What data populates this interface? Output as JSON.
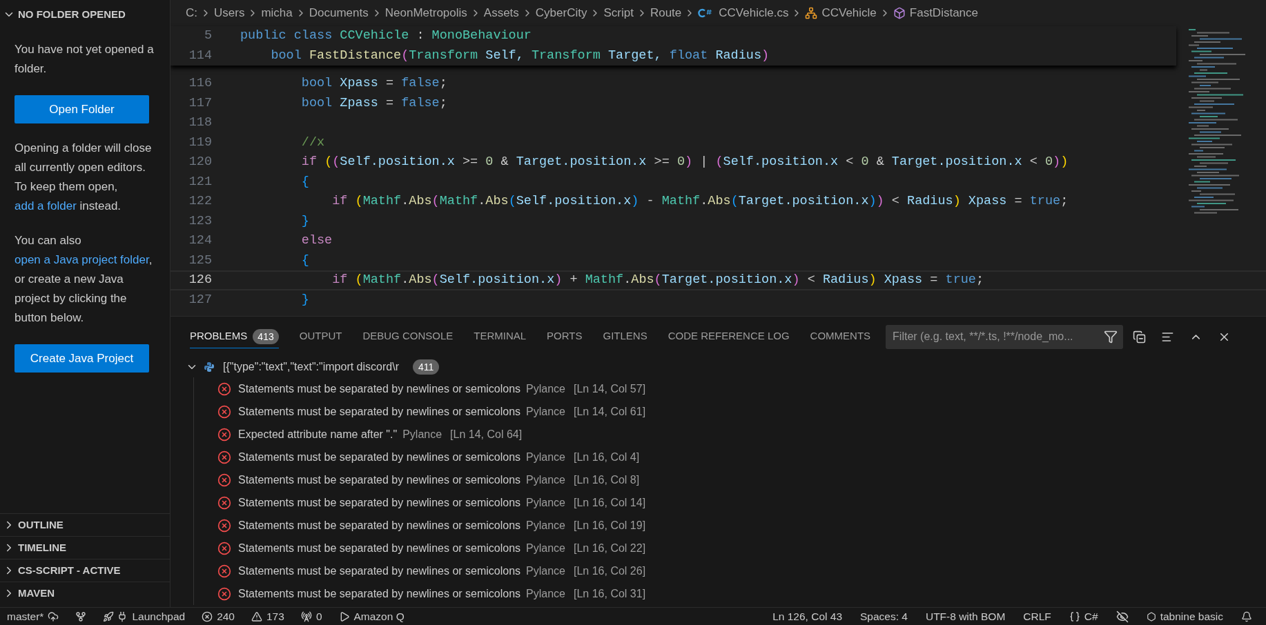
{
  "sidebar": {
    "title": "NO FOLDER OPENED",
    "expanded": true,
    "welcome": [
      {
        "kind": "text",
        "parts": [
          {
            "text": "You have not yet opened a folder.",
            "link": false
          }
        ]
      },
      {
        "kind": "button",
        "label": "Open Folder"
      },
      {
        "kind": "text",
        "parts": [
          {
            "text": "Opening a folder will close all currently open editors. To keep them open, ",
            "link": false
          },
          {
            "text": "add a folder",
            "link": true
          },
          {
            "text": " instead.",
            "link": false
          }
        ]
      },
      {
        "kind": "text",
        "parts": [
          {
            "text": "You can also ",
            "link": false
          },
          {
            "text": "open a Java project folder",
            "link": true
          },
          {
            "text": ", or create a new Java project by clicking the button below.",
            "link": false
          }
        ]
      },
      {
        "kind": "button",
        "label": "Create Java Project"
      }
    ],
    "sections": [
      {
        "label": "OUTLINE",
        "expanded": false
      },
      {
        "label": "TIMELINE",
        "expanded": false
      },
      {
        "label": "CS-SCRIPT - ACTIVE",
        "expanded": false
      },
      {
        "label": "MAVEN",
        "expanded": false
      }
    ]
  },
  "breadcrumb": [
    {
      "kind": "text",
      "label": "C:"
    },
    {
      "kind": "text",
      "label": "Users"
    },
    {
      "kind": "text",
      "label": "micha"
    },
    {
      "kind": "text",
      "label": "Documents"
    },
    {
      "kind": "text",
      "label": "NeonMetropolis"
    },
    {
      "kind": "text",
      "label": "Assets"
    },
    {
      "kind": "text",
      "label": "CyberCity"
    },
    {
      "kind": "text",
      "label": "Script"
    },
    {
      "kind": "text",
      "label": "Route"
    },
    {
      "kind": "file",
      "label": "CCVehicle.cs"
    },
    {
      "kind": "class",
      "label": "CCVehicle"
    },
    {
      "kind": "method",
      "label": "FastDistance"
    }
  ],
  "editor": {
    "sticky_lines": [
      {
        "number": "5",
        "current": false,
        "tokens": [
          {
            "text": "public",
            "kind": "keyword"
          },
          {
            "text": " class",
            "kind": "keyword"
          },
          {
            "text": " CCVehicle",
            "kind": "type"
          },
          {
            "text": " :",
            "kind": "plain"
          },
          {
            "text": " MonoBehaviour",
            "kind": "type"
          }
        ]
      },
      {
        "number": "114",
        "current": false,
        "tokens": [
          {
            "text": "    bool",
            "kind": "keyword"
          },
          {
            "text": " FastDistance",
            "kind": "function"
          },
          {
            "text": "(",
            "kind": "bracket2"
          },
          {
            "text": "Transform",
            "kind": "type"
          },
          {
            "text": " Self,",
            "kind": "variable"
          },
          {
            "text": " Transform",
            "kind": "type"
          },
          {
            "text": " Target,",
            "kind": "variable"
          },
          {
            "text": " float",
            "kind": "keyword"
          },
          {
            "text": " Radius",
            "kind": "variable"
          },
          {
            "text": ")",
            "kind": "bracket2"
          }
        ]
      }
    ],
    "lines": [
      {
        "number": "116",
        "current": false,
        "tokens": [
          {
            "text": "        bool",
            "kind": "keyword"
          },
          {
            "text": " Xpass",
            "kind": "variable"
          },
          {
            "text": " =",
            "kind": "plain"
          },
          {
            "text": " false",
            "kind": "keyword"
          },
          {
            "text": ";",
            "kind": "plain"
          }
        ]
      },
      {
        "number": "117",
        "current": false,
        "tokens": [
          {
            "text": "        bool",
            "kind": "keyword"
          },
          {
            "text": " Zpass",
            "kind": "variable"
          },
          {
            "text": " =",
            "kind": "plain"
          },
          {
            "text": " false",
            "kind": "keyword"
          },
          {
            "text": ";",
            "kind": "plain"
          }
        ]
      },
      {
        "number": "118",
        "current": false
      },
      {
        "number": "119",
        "current": false,
        "tokens": [
          {
            "text": "        //x",
            "kind": "comment"
          }
        ]
      },
      {
        "number": "120",
        "current": false,
        "tokens": [
          {
            "text": "        if",
            "kind": "control"
          },
          {
            "text": " (",
            "kind": "bracket1"
          },
          {
            "text": "(",
            "kind": "bracket2"
          },
          {
            "text": "Self.position.x",
            "kind": "variable"
          },
          {
            "text": " >=",
            "kind": "plain"
          },
          {
            "text": " 0",
            "kind": "number"
          },
          {
            "text": " &",
            "kind": "plain"
          },
          {
            "text": " Target.position.x",
            "kind": "variable"
          },
          {
            "text": " >=",
            "kind": "plain"
          },
          {
            "text": " 0",
            "kind": "number"
          },
          {
            "text": ")",
            "kind": "bracket2"
          },
          {
            "text": " |",
            "kind": "plain"
          },
          {
            "text": " (",
            "kind": "bracket2"
          },
          {
            "text": "Self.position.x",
            "kind": "variable"
          },
          {
            "text": " <",
            "kind": "plain"
          },
          {
            "text": " 0",
            "kind": "number"
          },
          {
            "text": " &",
            "kind": "plain"
          },
          {
            "text": " Target.position.x",
            "kind": "variable"
          },
          {
            "text": " <",
            "kind": "plain"
          },
          {
            "text": " 0",
            "kind": "number"
          },
          {
            "text": ")",
            "kind": "bracket2"
          },
          {
            "text": ")",
            "kind": "bracket1"
          }
        ]
      },
      {
        "number": "121",
        "current": false,
        "tokens": [
          {
            "text": "        {",
            "kind": "bracket3"
          }
        ]
      },
      {
        "number": "122",
        "current": false,
        "tokens": [
          {
            "text": "            if",
            "kind": "control"
          },
          {
            "text": " (",
            "kind": "bracket1"
          },
          {
            "text": "Mathf",
            "kind": "type"
          },
          {
            "text": ".",
            "kind": "plain"
          },
          {
            "text": "Abs",
            "kind": "function"
          },
          {
            "text": "(",
            "kind": "bracket2"
          },
          {
            "text": "Mathf",
            "kind": "type"
          },
          {
            "text": ".",
            "kind": "plain"
          },
          {
            "text": "Abs",
            "kind": "function"
          },
          {
            "text": "(",
            "kind": "bracket3"
          },
          {
            "text": "Self.position.x",
            "kind": "variable"
          },
          {
            "text": ")",
            "kind": "bracket3"
          },
          {
            "text": " -",
            "kind": "plain"
          },
          {
            "text": " Mathf",
            "kind": "type"
          },
          {
            "text": ".",
            "kind": "plain"
          },
          {
            "text": "Abs",
            "kind": "function"
          },
          {
            "text": "(",
            "kind": "bracket3"
          },
          {
            "text": "Target.position.x",
            "kind": "variable"
          },
          {
            "text": ")",
            "kind": "bracket3"
          },
          {
            "text": ")",
            "kind": "bracket2"
          },
          {
            "text": " <",
            "kind": "plain"
          },
          {
            "text": " Radius",
            "kind": "variable"
          },
          {
            "text": ")",
            "kind": "bracket1"
          },
          {
            "text": " Xpass",
            "kind": "variable"
          },
          {
            "text": " =",
            "kind": "plain"
          },
          {
            "text": " true",
            "kind": "keyword"
          },
          {
            "text": ";",
            "kind": "plain"
          }
        ]
      },
      {
        "number": "123",
        "current": false,
        "tokens": [
          {
            "text": "        }",
            "kind": "bracket3"
          }
        ]
      },
      {
        "number": "124",
        "current": false,
        "tokens": [
          {
            "text": "        else",
            "kind": "control"
          }
        ]
      },
      {
        "number": "125",
        "current": false,
        "tokens": [
          {
            "text": "        {",
            "kind": "bracket3"
          }
        ]
      },
      {
        "number": "126",
        "current": true,
        "tokens": [
          {
            "text": "            if",
            "kind": "control"
          },
          {
            "text": " (",
            "kind": "bracket1"
          },
          {
            "text": "Mathf",
            "kind": "type"
          },
          {
            "text": ".",
            "kind": "plain"
          },
          {
            "text": "Abs",
            "kind": "function"
          },
          {
            "text": "(",
            "kind": "bracket2"
          },
          {
            "text": "Self.position.x",
            "kind": "variable"
          },
          {
            "text": ")",
            "kind": "bracket2"
          },
          {
            "text": " +",
            "kind": "plain"
          },
          {
            "text": " Mathf",
            "kind": "type"
          },
          {
            "text": ".",
            "kind": "plain"
          },
          {
            "text": "Abs",
            "kind": "function"
          },
          {
            "text": "(",
            "kind": "bracket2"
          },
          {
            "text": "Target.position.x",
            "kind": "variable"
          },
          {
            "text": ")",
            "kind": "bracket2"
          },
          {
            "text": " <",
            "kind": "plain"
          },
          {
            "text": " Radius",
            "kind": "variable"
          },
          {
            "text": ")",
            "kind": "bracket1"
          },
          {
            "text": " Xpass",
            "kind": "variable"
          },
          {
            "text": " =",
            "kind": "plain"
          },
          {
            "text": " true",
            "kind": "keyword"
          },
          {
            "text": ";",
            "kind": "plain"
          }
        ]
      },
      {
        "number": "127",
        "current": false,
        "tokens": [
          {
            "text": "        }",
            "kind": "bracket3"
          }
        ]
      }
    ]
  },
  "panel": {
    "tabs": [
      {
        "label": "PROBLEMS",
        "selected": true,
        "badge": "413"
      },
      {
        "label": "OUTPUT",
        "selected": false
      },
      {
        "label": "DEBUG CONSOLE",
        "selected": false
      },
      {
        "label": "TERMINAL",
        "selected": false
      },
      {
        "label": "PORTS",
        "selected": false
      },
      {
        "label": "GITLENS",
        "selected": false
      },
      {
        "label": "CODE REFERENCE LOG",
        "selected": false
      },
      {
        "label": "COMMENTS",
        "selected": false
      }
    ],
    "filter": {
      "placeholder": "Filter (e.g. text, **/*.ts, !**/node_mo..."
    },
    "group": {
      "label": "[{\"type\":\"text\",\"text\":\"import discord\\r",
      "count": "411",
      "expanded": true
    },
    "problems": [
      {
        "message": "Statements must be separated by newlines or semicolons",
        "source": "Pylance",
        "location": "[Ln 14, Col 57]"
      },
      {
        "message": "Statements must be separated by newlines or semicolons",
        "source": "Pylance",
        "location": "[Ln 14, Col 61]"
      },
      {
        "message": "Expected attribute name after \".\"",
        "source": "Pylance",
        "location": "[Ln 14, Col 64]"
      },
      {
        "message": "Statements must be separated by newlines or semicolons",
        "source": "Pylance",
        "location": "[Ln 16, Col 4]"
      },
      {
        "message": "Statements must be separated by newlines or semicolons",
        "source": "Pylance",
        "location": "[Ln 16, Col 8]"
      },
      {
        "message": "Statements must be separated by newlines or semicolons",
        "source": "Pylance",
        "location": "[Ln 16, Col 14]"
      },
      {
        "message": "Statements must be separated by newlines or semicolons",
        "source": "Pylance",
        "location": "[Ln 16, Col 19]"
      },
      {
        "message": "Statements must be separated by newlines or semicolons",
        "source": "Pylance",
        "location": "[Ln 16, Col 22]"
      },
      {
        "message": "Statements must be separated by newlines or semicolons",
        "source": "Pylance",
        "location": "[Ln 16, Col 26]"
      },
      {
        "message": "Statements must be separated by newlines or semicolons",
        "source": "Pylance",
        "location": "[Ln 16, Col 31]"
      }
    ]
  },
  "status_bar": {
    "left": [
      {
        "kind": "branch",
        "label": "master*"
      },
      {
        "kind": "graph"
      },
      {
        "kind": "launchpad",
        "label": "Launchpad"
      },
      {
        "kind": "errors",
        "label": "240"
      },
      {
        "kind": "warnings",
        "label": "173"
      },
      {
        "kind": "ports",
        "label": "0"
      },
      {
        "kind": "run",
        "label": "Amazon Q"
      }
    ],
    "right": [
      {
        "kind": "text",
        "label": "Ln 126, Col 43"
      },
      {
        "kind": "text",
        "label": "Spaces: 4"
      },
      {
        "kind": "text",
        "label": "UTF-8 with BOM"
      },
      {
        "kind": "text",
        "label": "CRLF"
      },
      {
        "kind": "language",
        "label": "C#"
      },
      {
        "kind": "copilot"
      },
      {
        "kind": "tabnine",
        "label": "tabnine basic"
      },
      {
        "kind": "bell"
      }
    ]
  }
}
